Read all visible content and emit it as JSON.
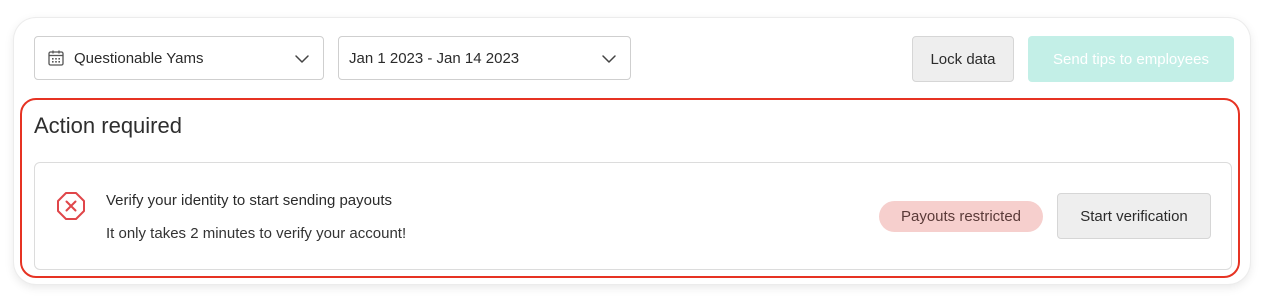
{
  "toolbar": {
    "location_select": {
      "value": "Questionable Yams",
      "icon": "calendar-icon"
    },
    "date_range_select": {
      "value": "Jan 1 2023 - Jan 14 2023"
    },
    "lock_button_label": "Lock data",
    "send_tips_button_label": "Send tips to employees"
  },
  "action_required": {
    "title": "Action required",
    "item": {
      "icon": "error-octagon-icon",
      "title": "Verify your identity to start sending payouts",
      "subtitle": "It only takes 2 minutes to verify your account!",
      "status_badge": "Payouts restricted",
      "button_label": "Start verification"
    }
  },
  "colors": {
    "highlight_border": "#e63323",
    "badge_bg": "#f6cfcd",
    "send_button_bg": "#c3efe7",
    "error_icon": "#e0464a"
  }
}
